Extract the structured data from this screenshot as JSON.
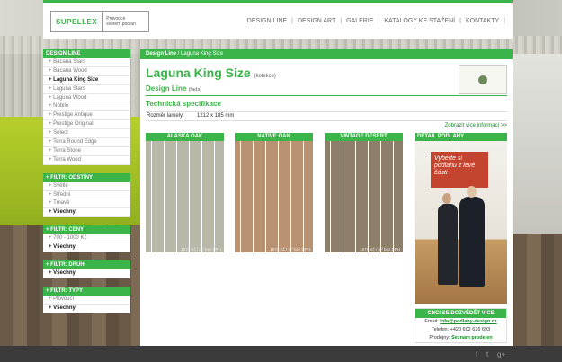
{
  "header": {
    "logo_brand": "SUPELLEX",
    "logo_tagline_1": "Průvodce",
    "logo_tagline_2": "světem podlah",
    "nav": [
      "DESIGN LINE",
      "DESIGN ART",
      "GALERIE",
      "KATALOGY KE STAŽENÍ",
      "KONTAKTY"
    ]
  },
  "sidebar": {
    "heading": "DESIGN LINE",
    "items": [
      "+ Bacana Stars",
      "+ Bacana Wood",
      "+ Laguna King Size",
      "+ Laguna Stars",
      "+ Laguna Wood",
      "+ Nobile",
      "+ Prestige Antique",
      "+ Prestige Original",
      "+ Select",
      "+ Terra Round Edge",
      "+ Terra Stone",
      "+ Terra Wood"
    ],
    "active_index": 2,
    "filters": [
      {
        "heading": "+ FILTR: ODSTÍNY",
        "items": [
          "+ Světlé",
          "+ Středni",
          "+ Tmavé"
        ],
        "all": "+ Všechny"
      },
      {
        "heading": "+ FILTR: CENY",
        "items": [
          "+ 700 - 1000 Kč"
        ],
        "all": "+ Všechny"
      },
      {
        "heading": "+ FILTR: DRUH",
        "items": [],
        "all": "+ Všechny"
      },
      {
        "heading": "+ FILTR: TYPY",
        "items": [
          "+ Plovoucí"
        ],
        "all": "+ Všechny"
      }
    ]
  },
  "main": {
    "breadcrumb_root": "Design Line",
    "breadcrumb_sep": " / ",
    "breadcrumb_current": "Laguna King Size",
    "title": "Laguna King Size",
    "title_suffix": "(kolekce)",
    "subtitle": "Design Line",
    "subtitle_suffix": "(řada)",
    "spec_heading": "Technická specifikace",
    "spec_label": "Rozměr lamely:",
    "spec_value": "1212 x 185 mm",
    "more_link": "Zobrazit více informací >>",
    "tiles": [
      {
        "name": "ALASKA OAK",
        "price": "1079 Kč / m² bez DPH",
        "color": "#b9b7a8"
      },
      {
        "name": "NATIVE OAK",
        "price": "1079 Kč / m² bez DPH",
        "color": "#b89272"
      },
      {
        "name": "VINTAGE DESERT",
        "price": "1079 Kč / m² bez DPH",
        "color": "#8d7f6a"
      }
    ]
  },
  "detail": {
    "heading": "DETAIL PODLAHY",
    "promo": "Vyberte si podlahu z levé části"
  },
  "contact": {
    "heading": "CHCI SE DOZVĚDĚT VÍCE",
    "email_label": "Email:",
    "email": "info@podlahy-design.cz",
    "phone": "Telefon: +420 602 626 693",
    "sales_label": "Prodejny:",
    "sales_link": "Seznam prodejen"
  },
  "social": {
    "icons": [
      "facebook-icon",
      "twitter-icon",
      "google-plus-icon"
    ],
    "glyphs": [
      "f",
      "t",
      "g+"
    ]
  }
}
